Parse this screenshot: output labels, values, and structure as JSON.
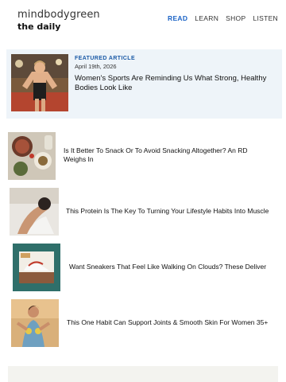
{
  "header": {
    "brand": "mindbodygreen",
    "subtitle": "the daily",
    "nav": [
      "READ",
      "LEARN",
      "SHOP",
      "LISTEN"
    ]
  },
  "featured": {
    "tag": "FEATURED ARTICLE",
    "date": "April 19th, 2026",
    "title": "Women's Sports Are Reminding Us What Strong, Healthy Bodies Look Like"
  },
  "articles": [
    {
      "title": "Is It Better To Snack Or To Avoid Snacking Altogether? An RD Weighs In"
    },
    {
      "title": "This Protein Is The Key To Turning Your Lifestyle Habits Into Muscle"
    },
    {
      "title": "Want Sneakers That Feel Like Walking On Clouds? These Deliver"
    },
    {
      "title": "This One Habit Can Support Joints & Smooth Skin For Women 35+"
    }
  ],
  "colors": {
    "accent": "#1b63c6",
    "featured_bg": "#eef4f9"
  }
}
